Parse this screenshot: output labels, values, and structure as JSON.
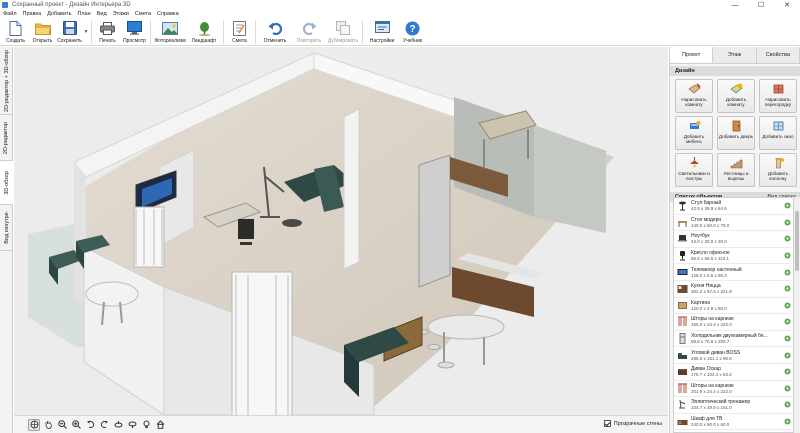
{
  "window": {
    "title": "Сохранный проект - Дизайн Интерьера 3D",
    "controls": [
      "—",
      "☐",
      "✕"
    ]
  },
  "menu": [
    "Файл",
    "Правка",
    "Добавить",
    "План",
    "Вид",
    "Этажи",
    "Смета",
    "Справка"
  ],
  "toolbar": {
    "create": "Создать",
    "open": "Открыть",
    "save": "Сохранить",
    "print": "Печать",
    "preview": "Просмотр",
    "photo": "Фотореализм",
    "landscape": "Ландшафт",
    "estimate": "Смета",
    "undo": "Отменить",
    "redo": "Повторить",
    "duplicate": "Дублировать",
    "settings": "Настройки",
    "help": "Учебник"
  },
  "left_tabs": [
    "2D-редактор + 3D-обзор",
    "2D-редактор",
    "3D-обзор",
    "Вид изнутри"
  ],
  "bottom": {
    "transparent_walls": "Прозрачные стены"
  },
  "right_panel": {
    "tabs": [
      "Проект",
      "Этаж",
      "Свойства"
    ],
    "design_header": "Дизайн",
    "design_buttons": [
      {
        "label": "Нарисовать комнату",
        "icon": "draw-room-icon"
      },
      {
        "label": "Добавить комнату",
        "icon": "add-room-icon"
      },
      {
        "label": "Нарисовать перегородку",
        "icon": "draw-partition-icon"
      },
      {
        "label": "Добавить мебель",
        "icon": "add-furniture-icon"
      },
      {
        "label": "Добавить дверь",
        "icon": "add-door-icon"
      },
      {
        "label": "Добавить окно",
        "icon": "add-window-icon"
      },
      {
        "label": "Светильники и люстры",
        "icon": "lamp-icon"
      },
      {
        "label": "Лестницы и вырезы",
        "icon": "stairs-icon"
      },
      {
        "label": "Добавить колонну",
        "icon": "column-icon"
      }
    ],
    "objects_header": "Список объектов",
    "objects_link": "Вид списка",
    "objects": [
      {
        "name": "Стул барный",
        "size": "42.5 x 39.9 x 84.6"
      },
      {
        "name": "Стол модерн",
        "size": "140.0 x 60.0 x 78.0"
      },
      {
        "name": "Ноутбук",
        "size": "43.0 x 30.0 x 30.0"
      },
      {
        "name": "Кресло офисное",
        "size": "66.6 x 66.6 x 110.1"
      },
      {
        "name": "Телевизор настенный",
        "size": "128.0 x 5.5 x 85.3"
      },
      {
        "name": "Кухня Ницца",
        "size": "302.2 x 57.6 x 221.8"
      },
      {
        "name": "Картина",
        "size": "120.0 x 2.9 x 80.0"
      },
      {
        "name": "Шторы на карнизе",
        "size": "165.0 x 24.4 x 222.0"
      },
      {
        "name": "Холодильник двухкамерный бе...",
        "size": "59.6 x 70.9 x 200.7"
      },
      {
        "name": "Угловой диван BOSS",
        "size": "285.6 x 161.1 x 90.6"
      },
      {
        "name": "Диван Оскар",
        "size": "175.7 x 102.4 x 83.2"
      },
      {
        "name": "Шторы на карнизе",
        "size": "201.9 x 24.4 x 222.0"
      },
      {
        "name": "Эллиптический тренажер",
        "size": "104.7 x 49.9 x 151.0"
      },
      {
        "name": "Шкаф для ТВ",
        "size": "240.0 x 60.0 x 60.0"
      }
    ]
  }
}
